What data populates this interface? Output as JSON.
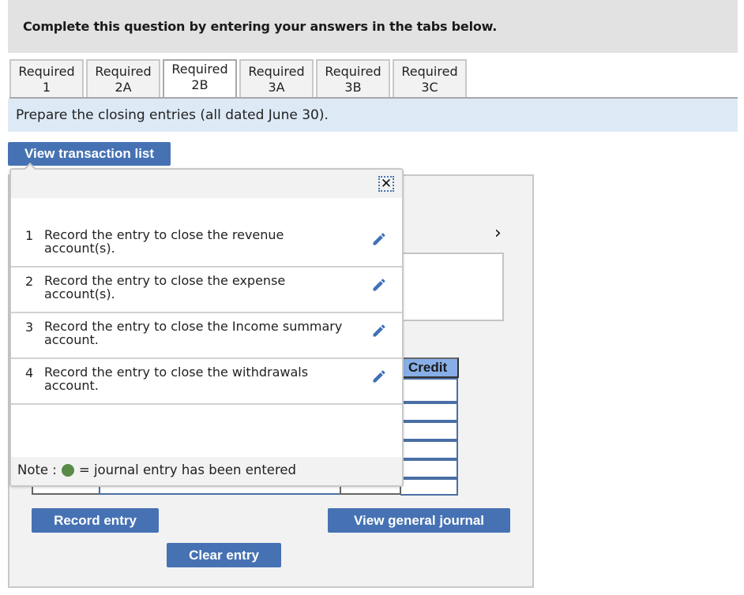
{
  "header": {
    "title": "Complete this question by entering your answers in the tabs below."
  },
  "tabs": [
    {
      "line1": "Required",
      "line2": "1",
      "active": false
    },
    {
      "line1": "Required",
      "line2": "2A",
      "active": false
    },
    {
      "line1": "Required",
      "line2": "2B",
      "active": true
    },
    {
      "line1": "Required",
      "line2": "3A",
      "active": false
    },
    {
      "line1": "Required",
      "line2": "3B",
      "active": false
    },
    {
      "line1": "Required",
      "line2": "3C",
      "active": false
    }
  ],
  "instruction": "Prepare the closing entries (all dated June 30).",
  "buttons": {
    "view_transaction_list": "View transaction list",
    "record_entry": "Record entry",
    "clear_entry": "Clear entry",
    "view_general_journal": "View general journal"
  },
  "popup": {
    "close_icon": "close-icon",
    "items": [
      {
        "num": "1",
        "text": "Record the entry to close the revenue account(s).",
        "icon": "pencil-icon"
      },
      {
        "num": "2",
        "text": "Record the entry to close the expense account(s).",
        "icon": "pencil-icon"
      },
      {
        "num": "3",
        "text": "Record the entry to close the Income summary account.",
        "icon": "pencil-icon"
      },
      {
        "num": "4",
        "text": "Record the entry to close the withdrawals account.",
        "icon": "pencil-icon"
      }
    ],
    "note_prefix": "Note :",
    "note_suffix": "= journal entry has been entered"
  },
  "journal": {
    "credit_header": "Credit",
    "next_icon": "chevron-right-icon"
  },
  "colors": {
    "button_blue": "#4672b4",
    "header_gray": "#e2e2e2",
    "instruction_blue": "#ddeaf6",
    "credit_header_blue": "#87aee6",
    "entered_green": "#5a8a48",
    "pencil_blue": "#3f6fb8"
  }
}
